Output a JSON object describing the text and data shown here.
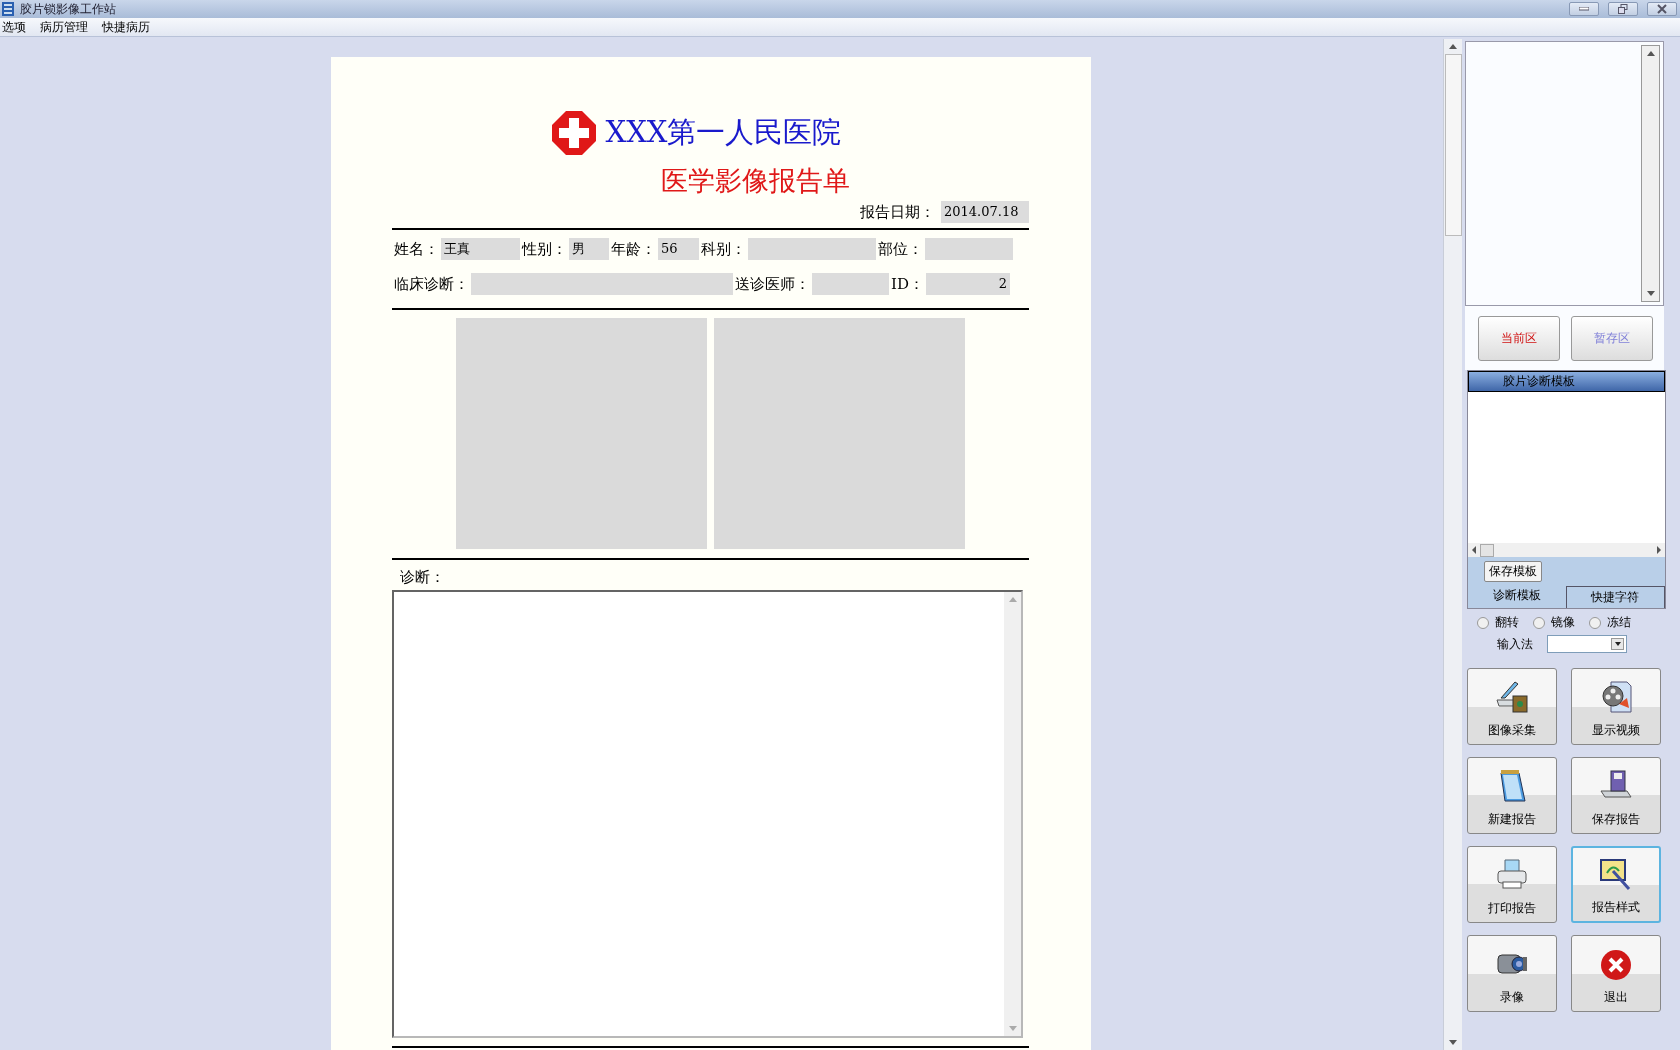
{
  "window": {
    "title": "胶片锁影像工作站"
  },
  "menu": [
    {
      "label": "选项"
    },
    {
      "label": "病历管理"
    },
    {
      "label": "快捷病历"
    }
  ],
  "report": {
    "hospital": "XXX第一人民医院",
    "title": "医学影像报告单",
    "date_label": "报告日期：",
    "date": "2014.07.18",
    "patient_fields": [
      {
        "label": "姓名：",
        "value": "王真"
      },
      {
        "label": "性别：",
        "value": "男"
      },
      {
        "label": "年龄：",
        "value": "56"
      },
      {
        "label": "科别："
      },
      {
        "label": "部位："
      }
    ],
    "referral_fields": [
      {
        "label": "临床诊断："
      },
      {
        "label": "送诊医师："
      },
      {
        "label": "ID：",
        "value": "2"
      }
    ],
    "images": [
      {
        "kind": "empty"
      },
      {
        "kind": "empty"
      }
    ],
    "diagnosis_label": "诊断："
  },
  "side": {
    "zones": [
      {
        "label": "当前区",
        "selected": true
      },
      {
        "label": "暂存区",
        "selected": false
      }
    ],
    "template_header": "胶片诊断模板",
    "save_template": "保存模板",
    "tabs": [
      {
        "label": "诊断模板",
        "selected": true
      },
      {
        "label": "快捷字符",
        "selected": false
      }
    ],
    "options": [
      {
        "label": "翻转",
        "checked": false
      },
      {
        "label": "镜像",
        "checked": false
      },
      {
        "label": "冻结",
        "checked": false
      }
    ],
    "input_method_label": "输入法",
    "actions": [
      {
        "label": "图像采集",
        "kind": "scanner",
        "focused": false
      },
      {
        "label": "显示视频",
        "kind": "film",
        "focused": false
      },
      {
        "label": "新建报告",
        "kind": "notepad",
        "focused": false
      },
      {
        "label": "保存报告",
        "kind": "floppy",
        "focused": false
      },
      {
        "label": "打印报告",
        "kind": "printer",
        "focused": false
      },
      {
        "label": "报告样式",
        "kind": "wand",
        "focused": true
      },
      {
        "label": "录像",
        "kind": "camcorder",
        "focused": false
      },
      {
        "label": "退出",
        "kind": "exit",
        "focused": false
      }
    ]
  }
}
